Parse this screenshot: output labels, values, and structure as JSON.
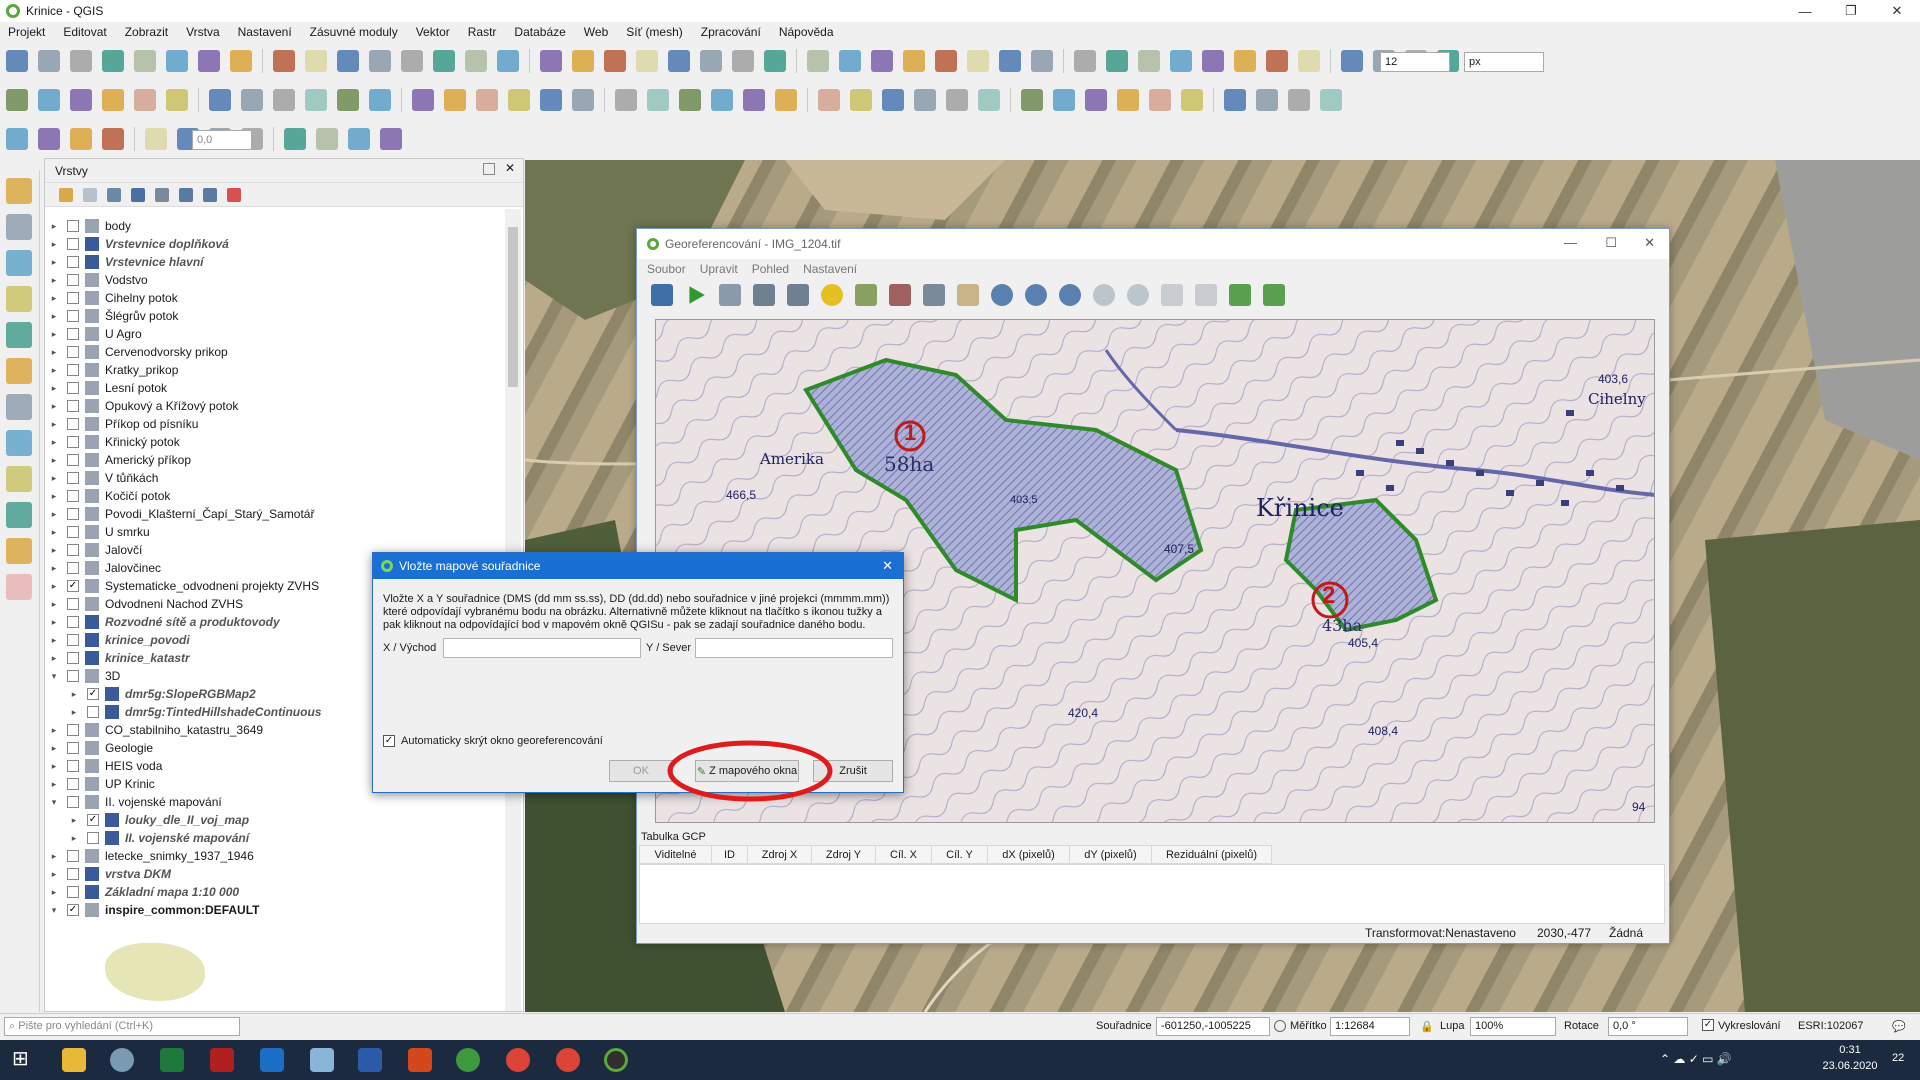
{
  "app": {
    "title": "Krinice - QGIS",
    "window_controls": [
      "—",
      "❐",
      "✕"
    ]
  },
  "menu": [
    "Projekt",
    "Editovat",
    "Zobrazit",
    "Vrstva",
    "Nastavení",
    "Zásuvné moduly",
    "Vektor",
    "Rastr",
    "Databáze",
    "Web",
    "Síť (mesh)",
    "Zpracování",
    "Nápověda"
  ],
  "toolbar": {
    "font_size_value": "12",
    "font_unit_value": "px",
    "label_offset_value": "0,0"
  },
  "layers_panel": {
    "title": "Vrstvy",
    "layers": [
      {
        "name": "body",
        "checked": false,
        "style": "normal"
      },
      {
        "name": "Vrstevnice doplňková",
        "checked": false,
        "style": "italic"
      },
      {
        "name": "Vrstevnice hlavní",
        "checked": false,
        "style": "italic"
      },
      {
        "name": "Vodstvo",
        "checked": false,
        "style": "normal"
      },
      {
        "name": "Cihelny potok",
        "checked": false,
        "style": "normal"
      },
      {
        "name": "Šlégrův potok",
        "checked": false,
        "style": "normal"
      },
      {
        "name": "U Agro",
        "checked": false,
        "style": "normal"
      },
      {
        "name": "Cervenodvorsky prikop",
        "checked": false,
        "style": "normal"
      },
      {
        "name": "Kratky_prikop",
        "checked": false,
        "style": "normal"
      },
      {
        "name": "Lesní potok",
        "checked": false,
        "style": "normal"
      },
      {
        "name": "Opukový a Křížový potok",
        "checked": false,
        "style": "normal"
      },
      {
        "name": "Příkop od písníku",
        "checked": false,
        "style": "normal"
      },
      {
        "name": "Křinický potok",
        "checked": false,
        "style": "normal"
      },
      {
        "name": "Americký příkop",
        "checked": false,
        "style": "normal"
      },
      {
        "name": "V tůňkách",
        "checked": false,
        "style": "normal"
      },
      {
        "name": "Kočičí potok",
        "checked": false,
        "style": "normal"
      },
      {
        "name": "Povodi_Klašterní_Čapí_Starý_Samotář",
        "checked": false,
        "style": "normal"
      },
      {
        "name": "U smrku",
        "checked": false,
        "style": "normal"
      },
      {
        "name": "Jalovčí",
        "checked": false,
        "style": "normal"
      },
      {
        "name": "Jalovčinec",
        "checked": false,
        "style": "normal"
      },
      {
        "name": "Systematicke_odvodneni projekty ZVHS",
        "checked": true,
        "style": "normal"
      },
      {
        "name": "Odvodneni Nachod ZVHS",
        "checked": false,
        "style": "normal"
      },
      {
        "name": "Rozvodné sítě a produktovody",
        "checked": false,
        "style": "italic"
      },
      {
        "name": "krinice_povodi",
        "checked": false,
        "style": "italic"
      },
      {
        "name": "krinice_katastr",
        "checked": false,
        "style": "italic"
      },
      {
        "name": "3D",
        "checked": false,
        "style": "normal"
      },
      {
        "name": "dmr5g:SlopeRGBMap2",
        "checked": true,
        "style": "italic"
      },
      {
        "name": "dmr5g:TintedHillshadeContinuous",
        "checked": false,
        "style": "italic"
      },
      {
        "name": "CO_stabilniho_katastru_3649",
        "checked": false,
        "style": "normal"
      },
      {
        "name": "Geologie",
        "checked": false,
        "style": "normal"
      },
      {
        "name": "HEIS voda",
        "checked": false,
        "style": "normal"
      },
      {
        "name": "UP Krinic",
        "checked": false,
        "style": "normal"
      },
      {
        "name": "II. vojenské mapování",
        "checked": false,
        "style": "normal"
      },
      {
        "name": "louky_dle_II_voj_map",
        "checked": true,
        "style": "italic"
      },
      {
        "name": "II. vojenské mapování",
        "checked": false,
        "style": "italic"
      },
      {
        "name": "letecke_snimky_1937_1946",
        "checked": false,
        "style": "normal"
      },
      {
        "name": "vrstva DKM",
        "checked": false,
        "style": "italic"
      },
      {
        "name": "Základní mapa 1:10 000",
        "checked": false,
        "style": "italic"
      },
      {
        "name": "inspire_common:DEFAULT",
        "checked": true,
        "style": "bold"
      }
    ]
  },
  "georef_window": {
    "title": "Georeferencování - IMG_1204.tif",
    "menu": [
      "Soubor",
      "Upravit",
      "Pohled",
      "Nastavení"
    ],
    "map_labels": {
      "area1_number": "1",
      "area1_size": "58ha",
      "area2_number": "2",
      "area2_size": "43ha",
      "town": "Křinice",
      "place_amerika": "Amerika",
      "place_cihelny": "Cihelny",
      "elev_1": "466,5",
      "elev_2": "407,5",
      "elev_3": "405,4",
      "elev_4": "420,4",
      "elev_5": "408,4",
      "elev_6": "403,6",
      "elev_7": "403,5",
      "corner": "94"
    },
    "gcp_table": {
      "title": "Tabulka GCP",
      "columns": [
        "Viditelné",
        "ID",
        "Zdroj X",
        "Zdroj Y",
        "Cíl. X",
        "Cíl. Y",
        "dX (pixelů)",
        "dY (pixelů)",
        "Reziduální (pixelů)"
      ]
    },
    "status": {
      "transform": "Transformovat:Nenastaveno",
      "coords": "2030,-477",
      "none": "Žádná"
    }
  },
  "dialog": {
    "title": "Vložte mapové souřadnice",
    "description": "Vložte X a Y souřadnice (DMS (dd mm ss.ss), DD (dd.dd) nebo souřadnice v jiné projekci (mmmm.mm)) které odpovídají vybranému bodu na obrázku. Alternativně můžete kliknout na tlačítko s ikonou tužky a pak kliknout na odpovídající bod v mapovém okně QGISu - pak se zadají souřadnice daného bodu.",
    "x_label": "X / Východ",
    "y_label": "Y / Sever",
    "x_value": "",
    "y_value": "",
    "auto_hide_label": "Automaticky skrýt okno georeferencování",
    "auto_hide_checked": true,
    "ok_label": "OK",
    "from_map_label": "Z mapového okna",
    "cancel_label": "Zrušit"
  },
  "statusbar": {
    "search_placeholder": "Pište pro vyhledání (Ctrl+K)",
    "coord_label": "Souřadnice",
    "coord_value": "-601250,-1005225",
    "scale_label": "Měřítko",
    "scale_value": "1:12684",
    "magnifier_label": "Lupa",
    "magnifier_value": "100%",
    "rotation_label": "Rotace",
    "rotation_value": "0,0 °",
    "render_label": "Vykreslování",
    "crs": "ESRI:102067"
  },
  "taskbar": {
    "time": "0:31",
    "date": "23.06.2020",
    "notifications": "22"
  },
  "colors": {
    "accent": "#1a70d2",
    "highlight_circle": "#e01b1b",
    "meadow_outline": "#2f8a2a",
    "meadow_fill": "#7e88c0"
  }
}
